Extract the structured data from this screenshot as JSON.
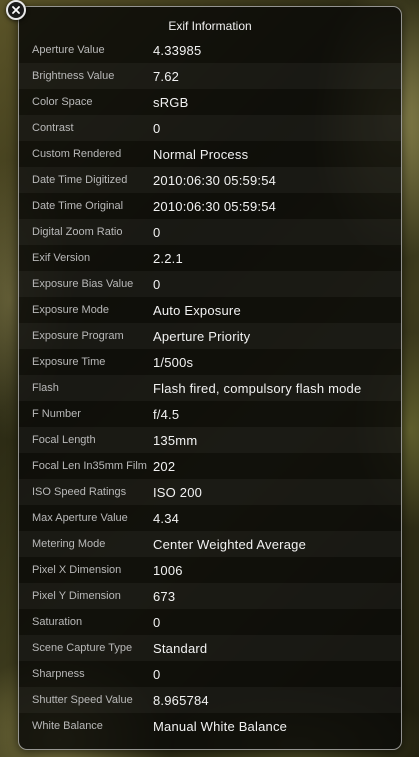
{
  "panel": {
    "title": "Exif Information"
  },
  "rows": [
    {
      "label": "Aperture Value",
      "value": "4.33985"
    },
    {
      "label": "Brightness Value",
      "value": "7.62"
    },
    {
      "label": "Color Space",
      "value": "sRGB"
    },
    {
      "label": "Contrast",
      "value": "0"
    },
    {
      "label": "Custom Rendered",
      "value": "Normal Process"
    },
    {
      "label": "Date Time Digitized",
      "value": "2010:06:30 05:59:54"
    },
    {
      "label": "Date Time Original",
      "value": "2010:06:30 05:59:54"
    },
    {
      "label": "Digital Zoom Ratio",
      "value": "0"
    },
    {
      "label": "Exif Version",
      "value": "2.2.1"
    },
    {
      "label": "Exposure Bias Value",
      "value": "0"
    },
    {
      "label": "Exposure Mode",
      "value": "Auto Exposure"
    },
    {
      "label": "Exposure Program",
      "value": "Aperture Priority"
    },
    {
      "label": "Exposure Time",
      "value": "1/500s"
    },
    {
      "label": "Flash",
      "value": "Flash fired, compulsory flash mode"
    },
    {
      "label": "F Number",
      "value": "f/4.5"
    },
    {
      "label": "Focal Length",
      "value": "135mm"
    },
    {
      "label": "Focal Len In35mm Film",
      "value": "202"
    },
    {
      "label": "ISO Speed Ratings",
      "value": "ISO 200"
    },
    {
      "label": "Max Aperture Value",
      "value": "4.34"
    },
    {
      "label": "Metering Mode",
      "value": "Center Weighted Average"
    },
    {
      "label": "Pixel X Dimension",
      "value": "1006"
    },
    {
      "label": "Pixel Y Dimension",
      "value": "673"
    },
    {
      "label": "Saturation",
      "value": "0"
    },
    {
      "label": "Scene Capture Type",
      "value": "Standard"
    },
    {
      "label": "Sharpness",
      "value": "0"
    },
    {
      "label": "Shutter Speed Value",
      "value": "8.965784"
    },
    {
      "label": "White Balance",
      "value": "Manual White Balance"
    }
  ]
}
